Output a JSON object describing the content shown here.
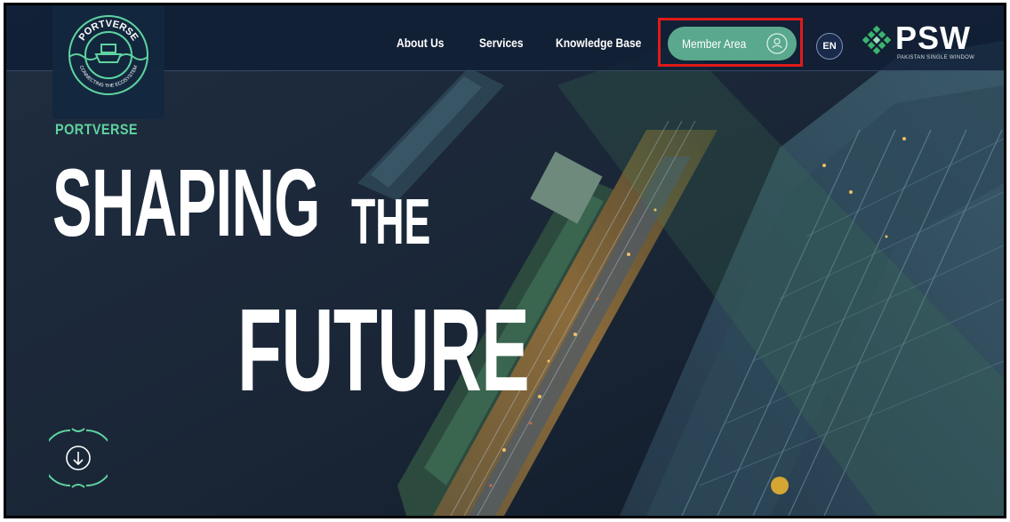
{
  "brand": {
    "emblem_top_text": "PORTVERSE",
    "emblem_bottom_text": "CONNECTING THE ECOSYSTEM",
    "name": "PORTVERSE"
  },
  "nav": {
    "items": [
      {
        "label": "About Us"
      },
      {
        "label": "Services"
      },
      {
        "label": "Knowledge Base"
      }
    ],
    "member_area": "Member Area",
    "member_icon": "user-icon",
    "language": "EN"
  },
  "partner_logo": {
    "name": "PSW",
    "subtitle": "PAKISTAN SINGLE WINDOW"
  },
  "hero": {
    "line1": "SHAPING",
    "connector": "THE",
    "line2": "FUTURE"
  },
  "colors": {
    "accent": "#5aa88d",
    "brand_green": "#5fd3a0",
    "highlight": "#e01a1a",
    "background": "#1c2a3c"
  },
  "icons": {
    "scroll": "scroll-down-icon"
  }
}
